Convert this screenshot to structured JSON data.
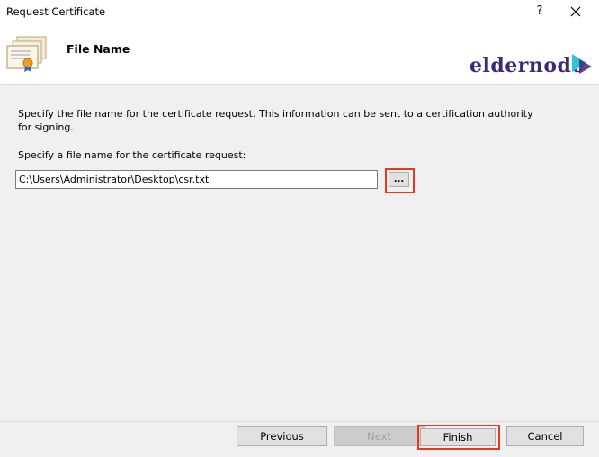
{
  "window": {
    "title": "Request Certificate",
    "help_label": "?"
  },
  "header": {
    "title": "File Name",
    "logo_text": "eldernode"
  },
  "content": {
    "description": "Specify the file name for the certificate request. This information can be sent to a certification authority for signing.",
    "field_label": "Specify a file name for the certificate request:",
    "file_path": "C:\\Users\\Administrator\\Desktop\\csr.txt",
    "browse_label": "..."
  },
  "footer": {
    "previous_label": "Previous",
    "next_label": "Next",
    "finish_label": "Finish",
    "cancel_label": "Cancel"
  },
  "colors": {
    "highlight": "#e8371b",
    "logo": "#3b2a7a",
    "logo_accent": "#2ec4d6"
  },
  "icons": [
    "certificate-icon",
    "close-icon",
    "logo-play-icon"
  ]
}
